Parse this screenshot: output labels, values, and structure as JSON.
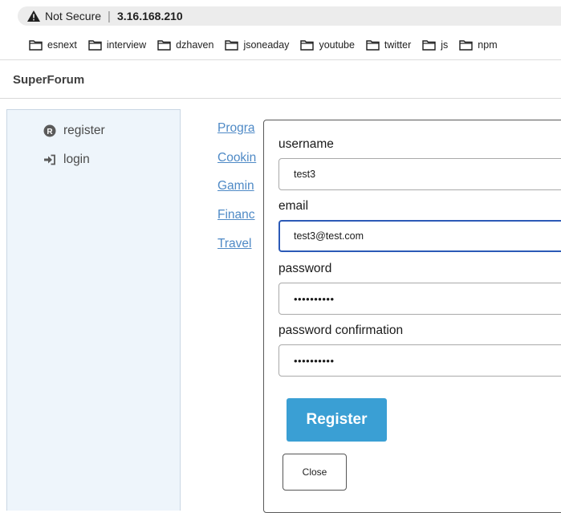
{
  "browser": {
    "security_label": "Not Secure",
    "host": "3.16.168.210",
    "bookmarks": [
      "esnext",
      "interview",
      "dzhaven",
      "jsoneaday",
      "youtube",
      "twitter",
      "js",
      "npm"
    ]
  },
  "app": {
    "title": "SuperForum"
  },
  "sidebar": {
    "items": [
      {
        "label": "register",
        "icon": "registered-icon"
      },
      {
        "label": "login",
        "icon": "sign-in-icon"
      }
    ]
  },
  "categories": [
    "Progra",
    "Cookin",
    "Gamin",
    "Financ",
    "Travel"
  ],
  "register_form": {
    "username_label": "username",
    "username_value": "test3",
    "email_label": "email",
    "email_value": "test3@test.com",
    "password_label": "password",
    "password_value": "••••••••••",
    "password_confirmation_label": "password confirmation",
    "password_confirmation_value": "••••••••••",
    "register_label": "Register",
    "close_label": "Close"
  },
  "colors": {
    "sidebar_bg": "#eef5fb",
    "link": "#4f8ac6",
    "register_button": "#3a9fd4",
    "focus_border": "#2c5ab7"
  }
}
